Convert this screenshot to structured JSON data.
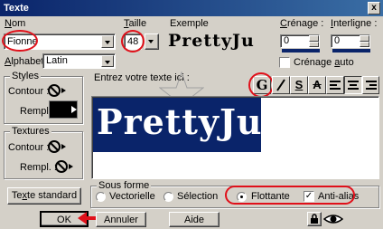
{
  "window": {
    "title": "Texte",
    "close_glyph": "x"
  },
  "nom": {
    "label_first": "N",
    "label_rest": "om",
    "value": "Fionne"
  },
  "taille": {
    "label_first": "T",
    "label_rest": "aille",
    "value": "48"
  },
  "exemple": {
    "label": "Exemple",
    "preview": "PrettyJu"
  },
  "crenage": {
    "label_first": "C",
    "label_rest": "rénage :",
    "value": "0"
  },
  "interligne": {
    "label_first": "I",
    "label_rest": "nterligne :",
    "value": "0"
  },
  "crenage_auto": {
    "label_before": "Crénage ",
    "label_u": "a",
    "label_after": "uto",
    "checked": false
  },
  "alphabet": {
    "label_first": "A",
    "label_rest": "lphabet :",
    "value": "Latin"
  },
  "styles": {
    "title": "Styles",
    "contour_label": "Contour :",
    "rempl_label": "Rempl. :"
  },
  "textures": {
    "title": "Textures",
    "contour_label": "Contour :",
    "rempl_label": "Rempl. :"
  },
  "text_area": {
    "prompt": "Entrez votre texte ici :",
    "content": "PrettyJu",
    "bg": "#0a246a"
  },
  "format_buttons": [
    "G",
    "I",
    "S",
    "A",
    "left",
    "center",
    "right"
  ],
  "texte_standard": {
    "label_first": "Te",
    "label_u": "x",
    "label_rest": "te standard"
  },
  "sous_forme": {
    "title": "Sous forme",
    "options": [
      {
        "label": "Vectorielle",
        "selected": false
      },
      {
        "label": "Sélection",
        "selected": false
      },
      {
        "label": "Flottante",
        "selected": true
      }
    ],
    "antialias": {
      "label": "Anti-alias",
      "checked": true
    }
  },
  "buttons": {
    "ok": "OK",
    "annuler": "Annuler",
    "aide": "Aide"
  },
  "colors": {
    "highlight": "#e0101a",
    "title_bar": "#0a246a"
  }
}
